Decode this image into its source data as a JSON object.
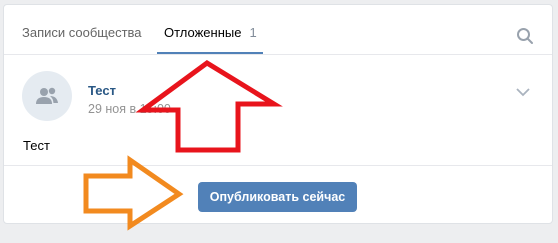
{
  "tabs": [
    {
      "label": "Записи сообщества"
    },
    {
      "label": "Отложенные",
      "count": "1"
    }
  ],
  "post": {
    "author": "Тест",
    "date": "29 ноя в 15:00",
    "text": "Тест"
  },
  "actions": {
    "publish_label": "Опубликовать сейчас"
  },
  "icons": {
    "search": "search-icon",
    "avatar": "community-avatar-icon",
    "chevron": "chevron-down-icon"
  },
  "colors": {
    "accent": "#5181b8",
    "link": "#2a5885",
    "annotation_red": "#e8141c",
    "annotation_orange": "#f28a1f"
  }
}
